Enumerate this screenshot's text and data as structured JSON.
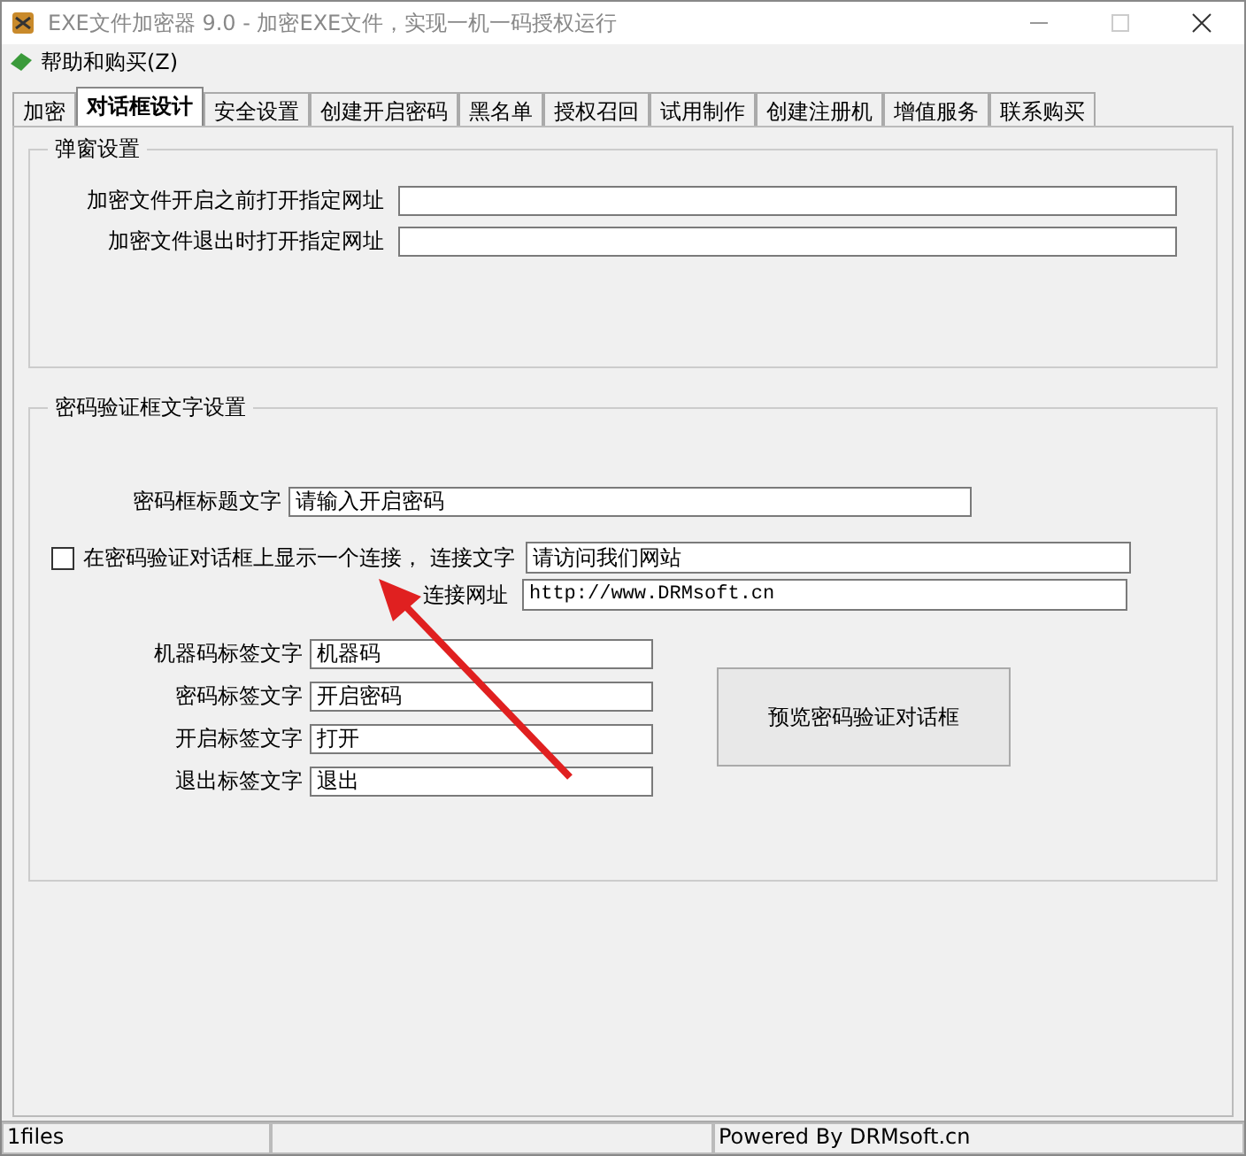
{
  "window": {
    "title": "EXE文件加密器 9.0 - 加密EXE文件，实现一机一码授权运行"
  },
  "menu": [
    "帮助和购买(Z)"
  ],
  "tabs": [
    {
      "label": "加密",
      "selected": false
    },
    {
      "label": "对话框设计",
      "selected": true
    },
    {
      "label": "安全设置",
      "selected": false
    },
    {
      "label": "创建开启密码",
      "selected": false
    },
    {
      "label": "黑名单",
      "selected": false
    },
    {
      "label": "授权召回",
      "selected": false
    },
    {
      "label": "试用制作",
      "selected": false
    },
    {
      "label": "创建注册机",
      "selected": false
    },
    {
      "label": "增值服务",
      "selected": false
    },
    {
      "label": "联系购买",
      "selected": false
    }
  ],
  "popup_group": {
    "title": "弹窗设置",
    "fields": [
      {
        "label": "加密文件开启之前打开指定网址"
      },
      {
        "label": "加密文件退出时打开指定网址"
      }
    ]
  },
  "dialog_group": {
    "title": "密码验证框文字设置",
    "title_field": {
      "label": "密码框标题文字",
      "value": "请输入开启密码"
    },
    "link_checkbox": {
      "label": "在密码验证对话框上显示一个连接，",
      "checked": false
    },
    "link_text": {
      "label": "连接文字",
      "value": "请访问我们网站"
    },
    "link_url": {
      "label": "连接网址",
      "value": "http://www.DRMsoft.cn"
    },
    "labels": [
      {
        "label": "机器码标签文字",
        "value": "机器码"
      },
      {
        "label": "密码标签文字",
        "value": "开启密码"
      },
      {
        "label": "开启标签文字",
        "value": "打开"
      },
      {
        "label": "退出标签文字",
        "value": "退出"
      }
    ],
    "preview_button": "预览密码验证对话框"
  },
  "status_bar": {
    "left": "1files",
    "right": "Powered By DRMsoft.cn"
  }
}
